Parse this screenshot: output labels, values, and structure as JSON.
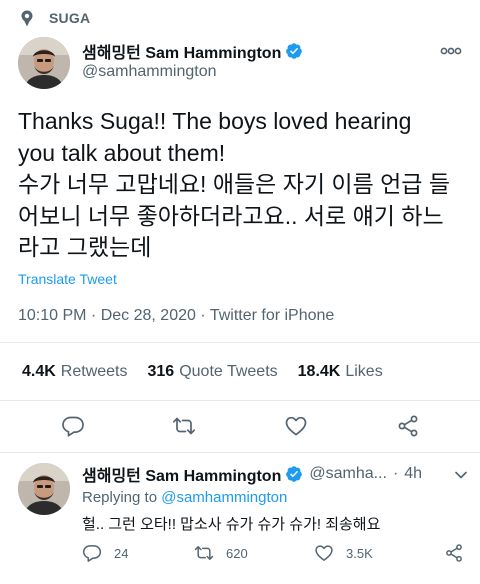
{
  "context": {
    "label": "SUGA",
    "icon": "pin-icon"
  },
  "tweet": {
    "author_name": "샘해밍턴 Sam Hammington",
    "handle": "@samhammington",
    "text": "Thanks Suga!! The boys loved hearing\nyou talk about them!\n수가 너무 고맙네요! 애들은 자기 이름 언급 들\n어보니 너무 좋아하더라고요.. 서로 얘기 하느\n라고 그랬는데",
    "translate_label": "Translate Tweet",
    "timestamp": "10:10 PM · Dec 28, 2020 · Twitter for iPhone",
    "stats": [
      {
        "count": "4.4K",
        "label": "Retweets"
      },
      {
        "count": "316",
        "label": "Quote Tweets"
      },
      {
        "count": "18.4K",
        "label": "Likes"
      }
    ]
  },
  "reply": {
    "author_name": "샘해밍턴 Sam Hammington",
    "handle": "@samha...",
    "separator": "·",
    "time": "4h",
    "replying_prefix": "Replying to ",
    "replying_to": "@samhammington",
    "text": "헐.. 그런 오타!! 맙소사 슈가 슈가 슈가! 죄송해요",
    "reply_count": "24",
    "retweet_count": "620",
    "like_count": "3.5K"
  },
  "colors": {
    "accent": "#1d9bf0",
    "secondary_text": "#536471",
    "divider": "#e7e9ea"
  }
}
